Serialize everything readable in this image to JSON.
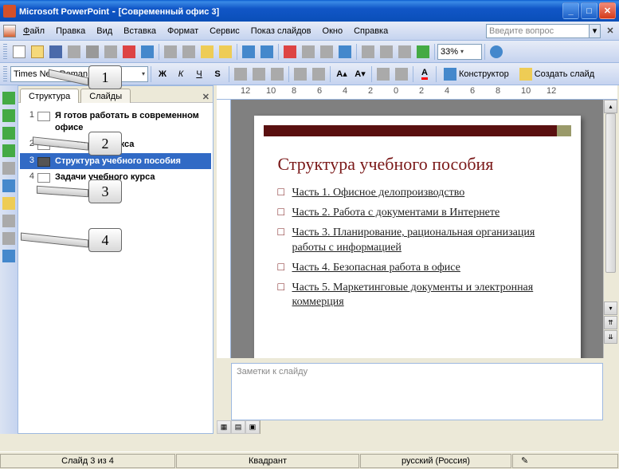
{
  "titlebar": {
    "app_name": "Microsoft PowerPoint",
    "document": "[Современный офис 3]"
  },
  "menu": {
    "file": "Файл",
    "edit": "Правка",
    "view": "Вид",
    "insert": "Вставка",
    "format": "Формат",
    "service": "Сервис",
    "slideshow": "Показ слайдов",
    "window": "Окно",
    "help": "Справка",
    "search_placeholder": "Введите вопрос"
  },
  "toolbar": {
    "zoom": "33%",
    "font_name": "Times New Roman",
    "constructor": "Конструктор",
    "new_slide": "Создать слайд"
  },
  "outline": {
    "tab_structure": "Структура",
    "tab_slides": "Слайды",
    "items": [
      {
        "num": "1",
        "title": "Я готов работать в современном офисе"
      },
      {
        "num": "2",
        "title": "Состав комплекса"
      },
      {
        "num": "3",
        "title": "Структура учебного пособия"
      },
      {
        "num": "4",
        "title": "Задачи учебного курса"
      }
    ],
    "selected_index": 2
  },
  "slide": {
    "title": "Структура учебного пособия",
    "bullets": [
      "Часть 1. Офисное делопроизводство",
      "Часть 2. Работа с документами в Интернете",
      "Часть 3. Планирование, рациональная организация работы с информацией",
      "Часть 4. Безопасная работа в офисе",
      "Часть 5. Маркетинговые документы и электронная коммерция"
    ]
  },
  "notes": {
    "placeholder": "Заметки к слайду"
  },
  "statusbar": {
    "slide_info": "Слайд 3 из 4",
    "design": "Квадрант",
    "language": "русский (Россия)"
  },
  "callouts": {
    "c1": "1",
    "c2": "2",
    "c3": "3",
    "c4": "4"
  },
  "ruler_labels": [
    "12",
    "10",
    "8",
    "6",
    "4",
    "2",
    "0",
    "2",
    "4",
    "6",
    "8",
    "10",
    "12"
  ]
}
